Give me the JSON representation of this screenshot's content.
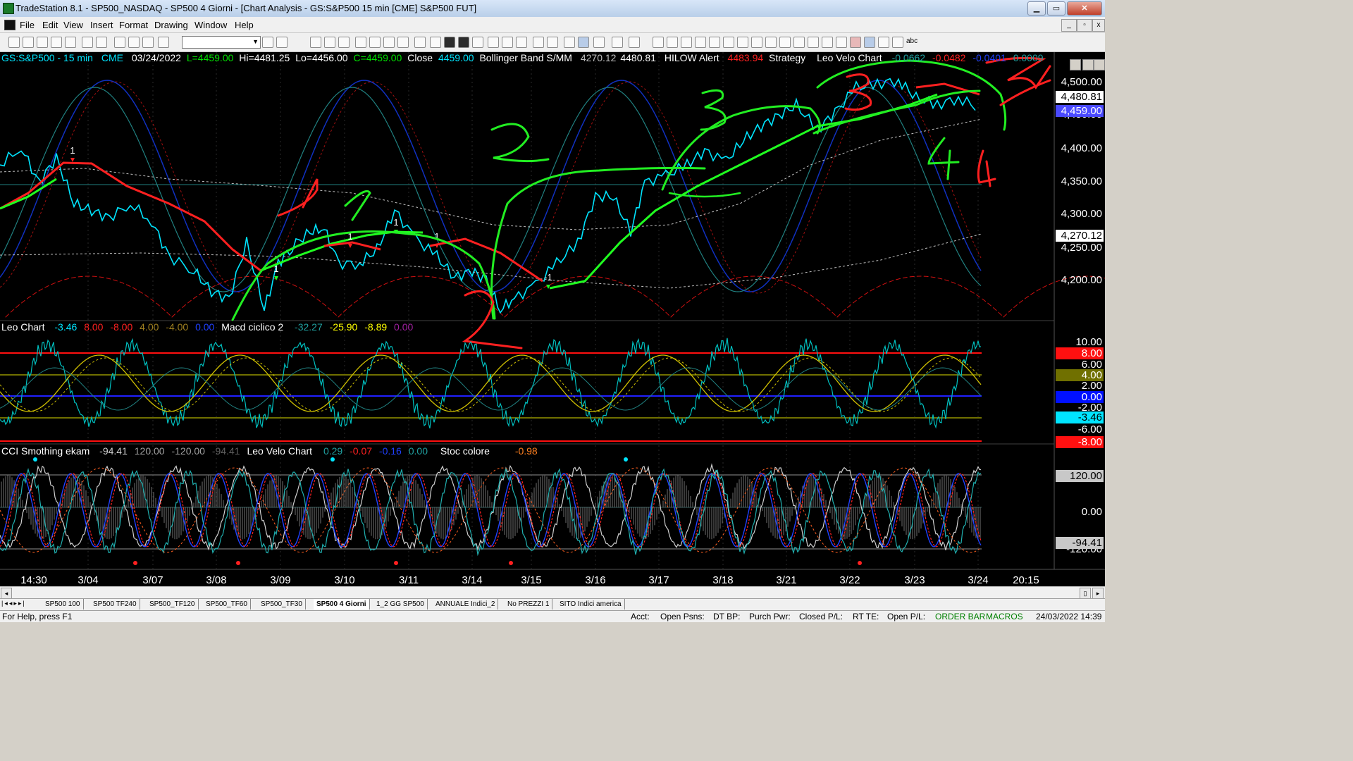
{
  "window": {
    "title": "TradeStation 8.1 - SP500_NASDAQ - SP500 4 Giorni - [Chart Analysis - GS:S&P500  15 min  [CME] S&P500 FUT]",
    "min_label": "▁",
    "max_label": "▭",
    "close_label": "✕"
  },
  "menu": {
    "items": [
      "File",
      "Edit",
      "View",
      "Insert",
      "Format",
      "Drawing",
      "Window",
      "Help"
    ]
  },
  "toolbar": {
    "symbol_value": "",
    "text_tool_label": "abc"
  },
  "chart": {
    "price_header": {
      "symbol": "GS:S&P500 - 15 min",
      "exchange": "CME",
      "date": "03/24/2022",
      "last": "L=4459.00",
      "hi": "Hi=4481.25",
      "lo": "Lo=4456.00",
      "close": "C=4459.00",
      "close_label": "Close",
      "close_value": "4459.00",
      "bb_label": "Bollinger Band S/MM",
      "bb_v1": "4270.12",
      "bb_v2": "4480.81",
      "hilow_label": "HILOW Alert",
      "hilow_value": "4483.94",
      "strategy_label": "Strategy",
      "velo_label": "Leo Velo Chart",
      "velo_v1": "-0.0662",
      "velo_v2": "-0.0482",
      "velo_v3": "-0.0401",
      "velo_v4": "0.0009"
    },
    "price_axis": [
      "4,500.00",
      "4,450.00",
      "4,400.00",
      "4,350.00",
      "4,300.00",
      "4,250.00",
      "4,200.00"
    ],
    "price_tags": {
      "upper_bb": "4,480.81",
      "last": "4,459.00",
      "lower_bb": "4,270.12"
    },
    "leo_header": {
      "label": "Leo Chart",
      "v1": "-3.46",
      "v2": "8.00",
      "v3": "-8.00",
      "v4": "4.00",
      "v5": "-4.00",
      "v6": "0.00",
      "macd_label": "Macd ciclico 2",
      "m1": "-32.27",
      "m2": "-25.90",
      "m3": "-8.89",
      "m4": "0.00"
    },
    "leo_axis": [
      "10.00",
      "6.00",
      "2.00",
      "-2.00",
      "-6.00"
    ],
    "leo_tags": {
      "t8": "8.00",
      "t4": "4.00",
      "t0": "0.00",
      "tv": "-3.46",
      "tm8": "-8.00"
    },
    "cci_header": {
      "label": "CCI Smothing ekam",
      "v1": "-94.41",
      "v2": "120.00",
      "v3": "-120.00",
      "v4": "-94.41",
      "velo_label": "Leo Velo Chart",
      "l1": "0.29",
      "l2": "-0.07",
      "l3": "-0.16",
      "l4": "0.00",
      "stoc_label": "Stoc colore",
      "stoc_value": "-0.98"
    },
    "cci_axis": {
      "top": "120.00",
      "mid": "0.00",
      "bottom": "-120.00"
    },
    "cci_tag": "-94.41",
    "time_axis": [
      "14:30",
      "3/04",
      "3/07",
      "3/08",
      "3/09",
      "3/10",
      "3/11",
      "3/14",
      "3/15",
      "3/16",
      "3/17",
      "3/18",
      "3/21",
      "3/22",
      "3/23",
      "3/24",
      "20:15"
    ],
    "signal_labels": [
      "1",
      "1",
      "1",
      "1",
      "1",
      "-1"
    ],
    "annotations": [
      "1",
      "1",
      "2",
      "2",
      "3",
      "3",
      "4",
      "4",
      "5"
    ]
  },
  "tabs": [
    "SP500 100",
    "SP500 TF240",
    "SP500_TF120",
    "SP500_TF60",
    "SP500_TF30",
    "SP500 4 Giorni",
    "1_2 GG SP500",
    "ANNUALE Indici_2",
    "No PREZZI 1",
    "SITO Indici america"
  ],
  "status": {
    "help": "For Help, press F1",
    "acct": "Acct:",
    "open_psns": "Open Psns:",
    "dt_bp": "DT BP:",
    "purch_pwr": "Purch Pwr:",
    "closed_pl": "Closed P/L:",
    "rt_te": "RT TE:",
    "open_pl": "Open P/L:",
    "order_bar": "ORDER BAR",
    "macros": "MACROS",
    "datetime": "24/03/2022 14:39"
  },
  "colors": {
    "price": "#00e5ff",
    "bb_center": "#c0c0c0",
    "annotation_green": "#22ee22",
    "annotation_red": "#ff2020",
    "status_green": "#008000"
  }
}
